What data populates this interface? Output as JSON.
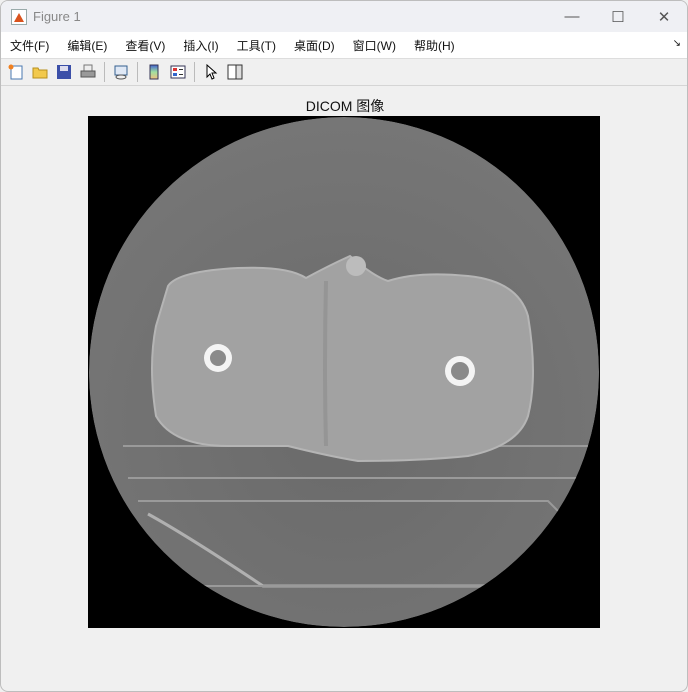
{
  "window": {
    "title": "Figure 1",
    "controls": {
      "minimize": "—",
      "maximize": "☐",
      "close": "✕"
    }
  },
  "menu": [
    "文件(F)",
    "编辑(E)",
    "查看(V)",
    "插入(I)",
    "工具(T)",
    "桌面(D)",
    "窗口(W)",
    "帮助(H)"
  ],
  "toolbar": [
    "new-figure",
    "open-file",
    "save",
    "print",
    "link-plot",
    "colorbar",
    "legend",
    "edit-plot",
    "property-inspector"
  ],
  "figure": {
    "title": "DICOM 图像"
  },
  "colors": {
    "background": "#000000",
    "scan_field": "#6e6e6e",
    "tissue": "#a3a3a3",
    "bone": "#f2f2f2"
  }
}
